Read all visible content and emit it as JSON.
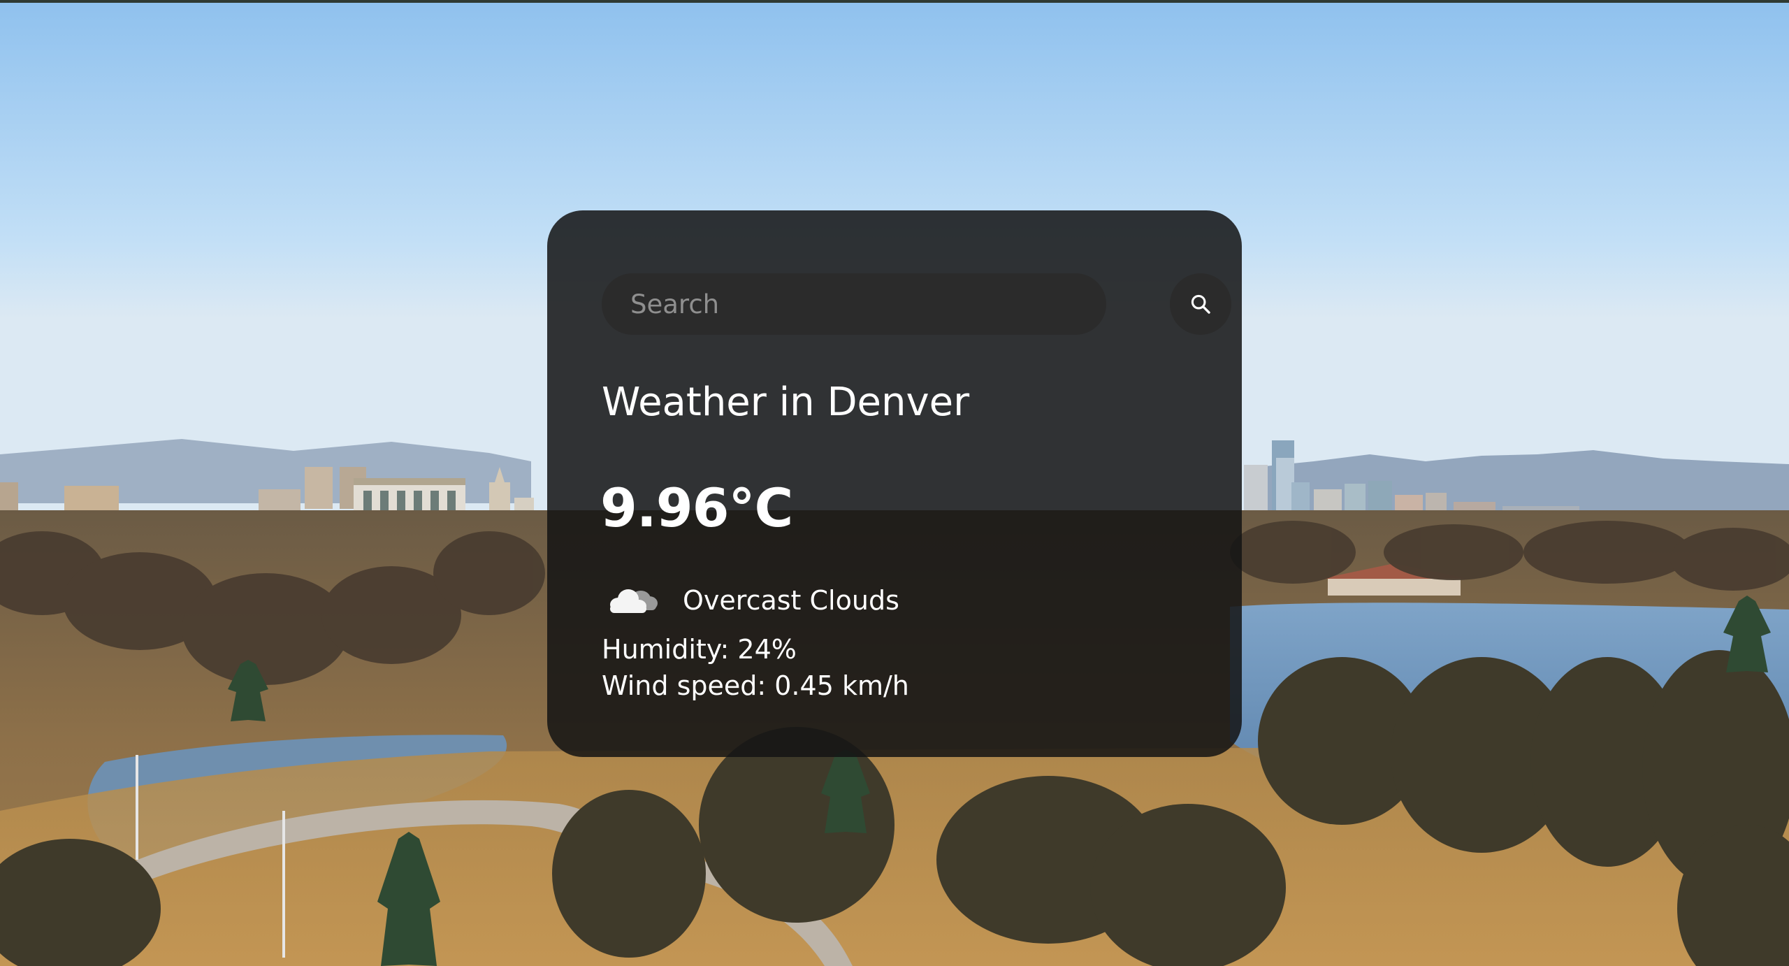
{
  "search": {
    "placeholder": "Search",
    "value": ""
  },
  "weather": {
    "title": "Weather in Denver",
    "temperature": "9.96°C",
    "description": "Overcast Clouds",
    "humidity": "Humidity: 24%",
    "wind": "Wind speed: 0.45 km/h",
    "icon": "overcast-clouds-icon"
  },
  "icons": {
    "search_button": "search-icon"
  },
  "colors": {
    "card_background": "#141414",
    "input_background": "#2b2b2b",
    "text": "#ffffff",
    "placeholder": "#8f8f8f"
  }
}
